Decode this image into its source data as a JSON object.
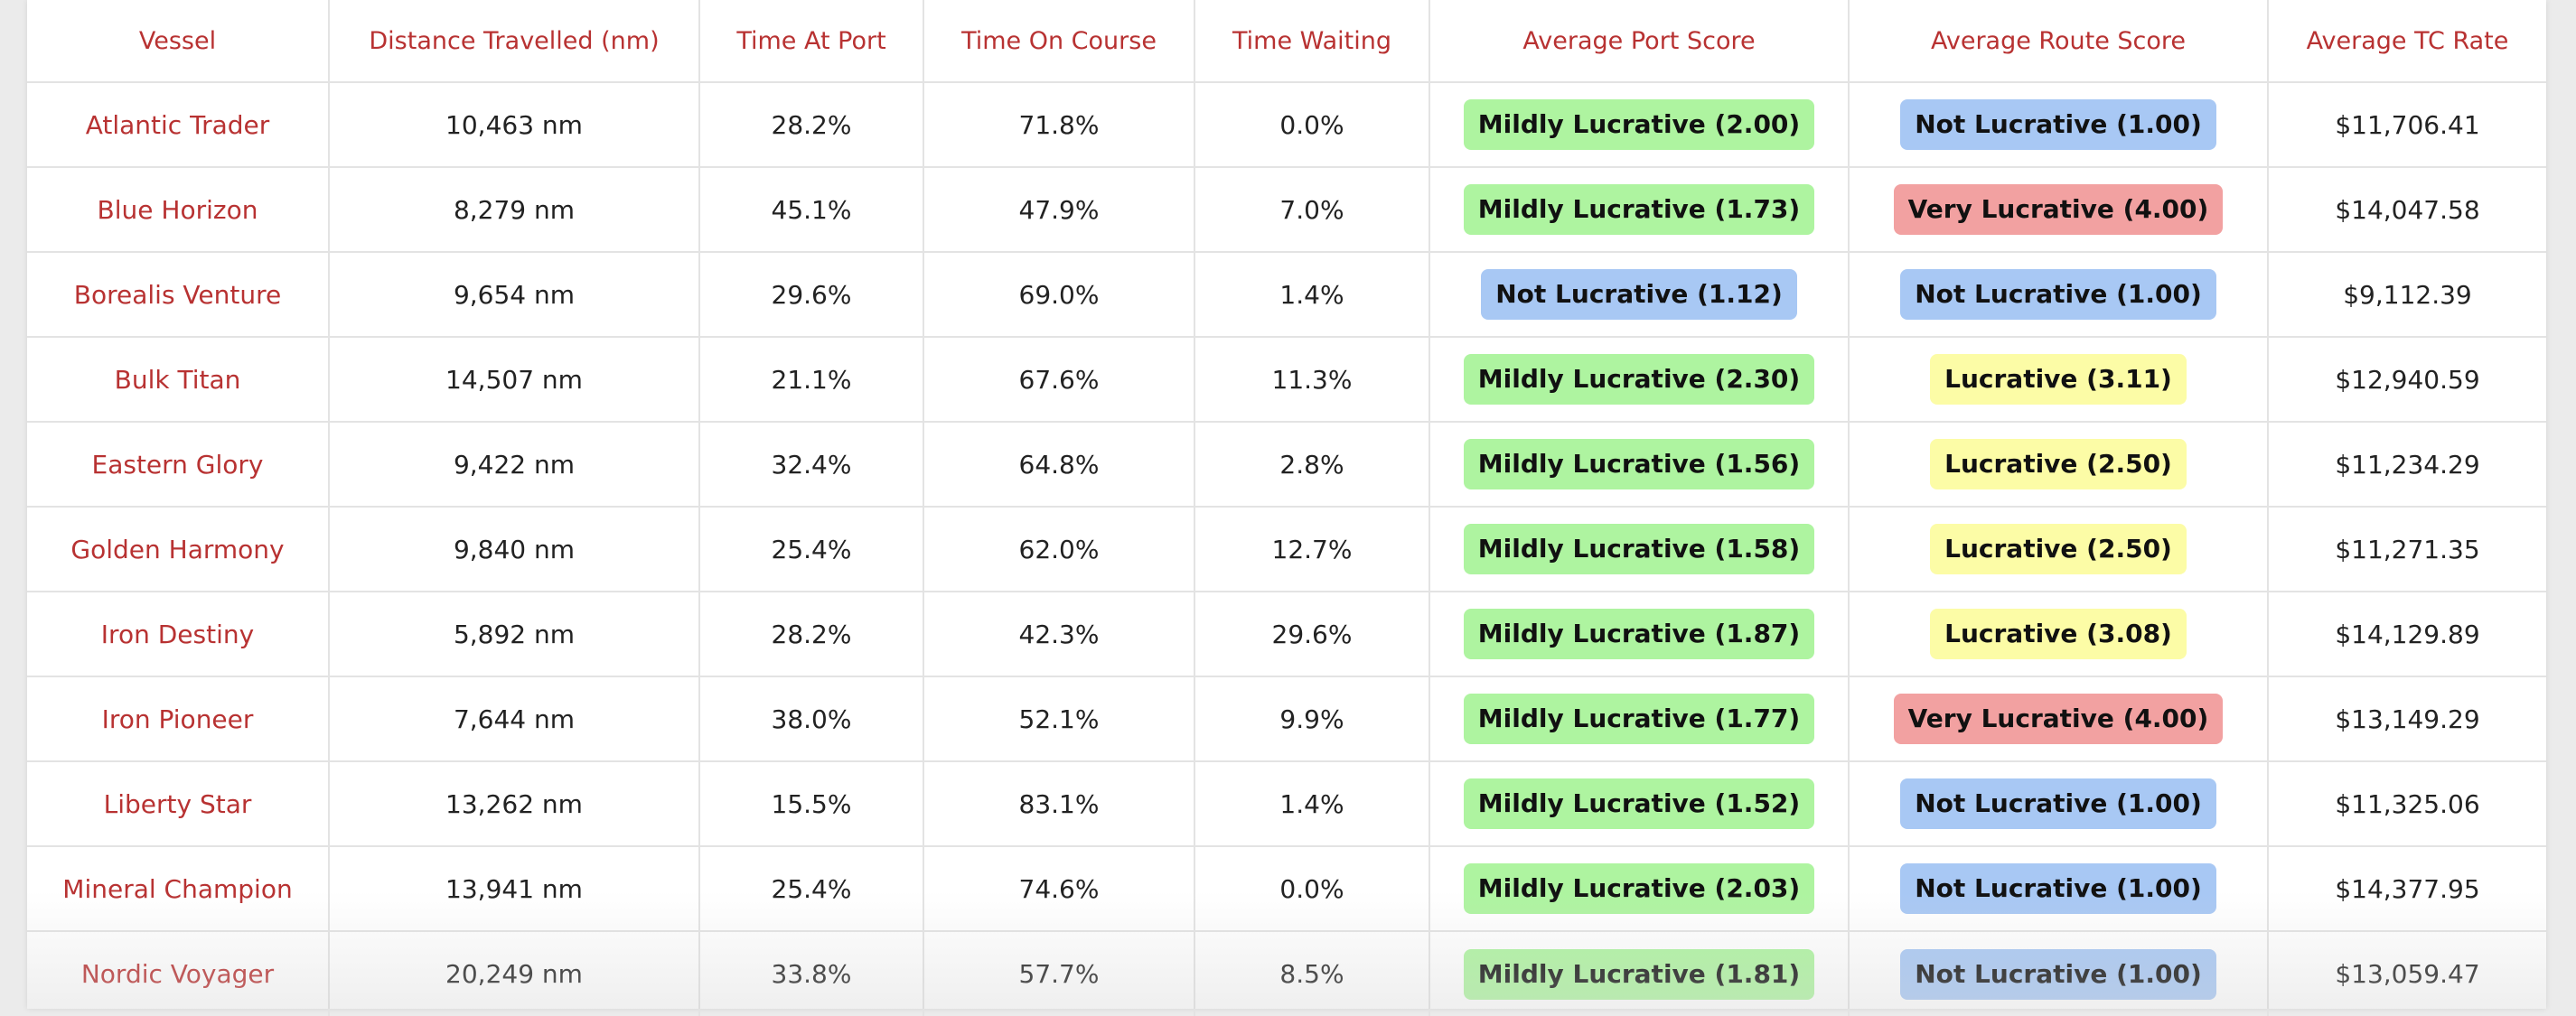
{
  "theme": {
    "header_color": "#b83232",
    "vessel_color": "#b83232",
    "badge_colors": {
      "Mildly Lucrative": "#aef4a0",
      "Not Lucrative": "#a8c8f4",
      "Very Lucrative": "#f2a1a1",
      "Lucrative": "#fcfca6"
    }
  },
  "table": {
    "headers": [
      "Vessel",
      "Distance Travelled (nm)",
      "Time At Port",
      "Time On Course",
      "Time Waiting",
      "Average Port Score",
      "Average Route Score",
      "Average TC Rate"
    ],
    "rows": [
      {
        "vessel": "Atlantic Trader",
        "distance": "10,463 nm",
        "port": "28.2%",
        "course": "71.8%",
        "waiting": "0.0%",
        "port_score": {
          "label": "Mildly Lucrative (2.00)",
          "level": "Mildly Lucrative"
        },
        "route_score": {
          "label": "Not Lucrative (1.00)",
          "level": "Not Lucrative"
        },
        "tc_rate": "$11,706.41"
      },
      {
        "vessel": "Blue Horizon",
        "distance": "8,279 nm",
        "port": "45.1%",
        "course": "47.9%",
        "waiting": "7.0%",
        "port_score": {
          "label": "Mildly Lucrative (1.73)",
          "level": "Mildly Lucrative"
        },
        "route_score": {
          "label": "Very Lucrative (4.00)",
          "level": "Very Lucrative"
        },
        "tc_rate": "$14,047.58"
      },
      {
        "vessel": "Borealis Venture",
        "distance": "9,654 nm",
        "port": "29.6%",
        "course": "69.0%",
        "waiting": "1.4%",
        "port_score": {
          "label": "Not Lucrative (1.12)",
          "level": "Not Lucrative"
        },
        "route_score": {
          "label": "Not Lucrative (1.00)",
          "level": "Not Lucrative"
        },
        "tc_rate": "$9,112.39"
      },
      {
        "vessel": "Bulk Titan",
        "distance": "14,507 nm",
        "port": "21.1%",
        "course": "67.6%",
        "waiting": "11.3%",
        "port_score": {
          "label": "Mildly Lucrative (2.30)",
          "level": "Mildly Lucrative"
        },
        "route_score": {
          "label": "Lucrative (3.11)",
          "level": "Lucrative"
        },
        "tc_rate": "$12,940.59"
      },
      {
        "vessel": "Eastern Glory",
        "distance": "9,422 nm",
        "port": "32.4%",
        "course": "64.8%",
        "waiting": "2.8%",
        "port_score": {
          "label": "Mildly Lucrative (1.56)",
          "level": "Mildly Lucrative"
        },
        "route_score": {
          "label": "Lucrative (2.50)",
          "level": "Lucrative"
        },
        "tc_rate": "$11,234.29"
      },
      {
        "vessel": "Golden Harmony",
        "distance": "9,840 nm",
        "port": "25.4%",
        "course": "62.0%",
        "waiting": "12.7%",
        "port_score": {
          "label": "Mildly Lucrative (1.58)",
          "level": "Mildly Lucrative"
        },
        "route_score": {
          "label": "Lucrative (2.50)",
          "level": "Lucrative"
        },
        "tc_rate": "$11,271.35"
      },
      {
        "vessel": "Iron Destiny",
        "distance": "5,892 nm",
        "port": "28.2%",
        "course": "42.3%",
        "waiting": "29.6%",
        "port_score": {
          "label": "Mildly Lucrative (1.87)",
          "level": "Mildly Lucrative"
        },
        "route_score": {
          "label": "Lucrative (3.08)",
          "level": "Lucrative"
        },
        "tc_rate": "$14,129.89"
      },
      {
        "vessel": "Iron Pioneer",
        "distance": "7,644 nm",
        "port": "38.0%",
        "course": "52.1%",
        "waiting": "9.9%",
        "port_score": {
          "label": "Mildly Lucrative (1.77)",
          "level": "Mildly Lucrative"
        },
        "route_score": {
          "label": "Very Lucrative (4.00)",
          "level": "Very Lucrative"
        },
        "tc_rate": "$13,149.29"
      },
      {
        "vessel": "Liberty Star",
        "distance": "13,262 nm",
        "port": "15.5%",
        "course": "83.1%",
        "waiting": "1.4%",
        "port_score": {
          "label": "Mildly Lucrative (1.52)",
          "level": "Mildly Lucrative"
        },
        "route_score": {
          "label": "Not Lucrative (1.00)",
          "level": "Not Lucrative"
        },
        "tc_rate": "$11,325.06"
      },
      {
        "vessel": "Mineral Champion",
        "distance": "13,941 nm",
        "port": "25.4%",
        "course": "74.6%",
        "waiting": "0.0%",
        "port_score": {
          "label": "Mildly Lucrative (2.03)",
          "level": "Mildly Lucrative"
        },
        "route_score": {
          "label": "Not Lucrative (1.00)",
          "level": "Not Lucrative"
        },
        "tc_rate": "$14,377.95"
      },
      {
        "vessel": "Nordic Voyager",
        "distance": "20,249 nm",
        "port": "33.8%",
        "course": "57.7%",
        "waiting": "8.5%",
        "port_score": {
          "label": "Mildly Lucrative (1.81)",
          "level": "Mildly Lucrative"
        },
        "route_score": {
          "label": "Not Lucrative (1.00)",
          "level": "Not Lucrative"
        },
        "tc_rate": "$13,059.47"
      }
    ]
  }
}
